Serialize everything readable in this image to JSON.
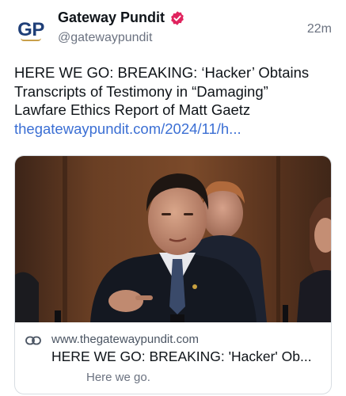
{
  "post": {
    "avatar_text": "GP",
    "display_name": "Gateway Pundit",
    "handle": "@gatewaypundit",
    "time": "22m",
    "verified_icon": "verified-badge-icon",
    "text_lines": [
      "HERE WE GO: BREAKING: ‘Hacker’ Obtains",
      "Transcripts of Testimony in “Damaging”",
      "Lawfare Ethics Report of Matt Gaetz"
    ],
    "link_text": "thegatewaypundit.com/2024/11/h..."
  },
  "card": {
    "domain": "www.thegatewaypundit.com",
    "title": "HERE WE GO: BREAKING: 'Hacker' Ob...",
    "description": "Here we go.",
    "link_icon": "link-chain-icon"
  },
  "colors": {
    "avatar_brand": "#1f3f78",
    "avatar_accent": "#c9a04a",
    "verified_badge": "#e0245e",
    "link": "#3b6fd4",
    "muted_text": "#6b7280"
  }
}
